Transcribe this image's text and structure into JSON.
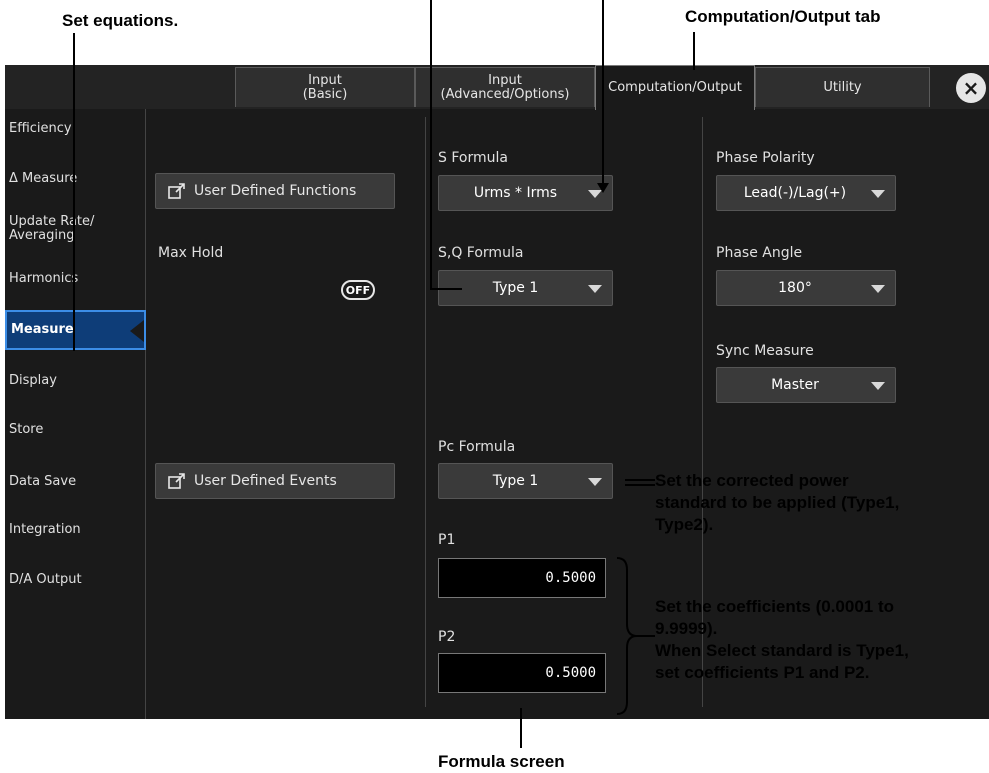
{
  "annotations": {
    "set_equations": "Set equations.",
    "tab_callout": "Computation/Output tab",
    "pc_note": [
      "Set the corrected power",
      "standard to be applied (Type1,",
      "Type2)."
    ],
    "coef_note": [
      "Set the coefficients (0.0001 to",
      "9.9999).",
      "When Select standard is Type1,",
      "set coefficients P1 and P2."
    ],
    "formula_screen": "Formula screen"
  },
  "tabs": [
    {
      "line1": "Input",
      "line2": "(Basic)"
    },
    {
      "line1": "Input",
      "line2": "(Advanced/Options)"
    },
    {
      "line1": "Computation/Output",
      "line2": ""
    },
    {
      "line1": "Utility",
      "line2": ""
    }
  ],
  "close_icon": "×",
  "sidebar": {
    "items": [
      {
        "label": "Efficiency"
      },
      {
        "label": "Δ Measure"
      },
      {
        "label": "Update Rate/ Averaging"
      },
      {
        "label": "Harmonics"
      },
      {
        "label": "Measure"
      },
      {
        "label": "Display"
      },
      {
        "label": "Store"
      },
      {
        "label": "Data Save"
      },
      {
        "label": "Integration"
      },
      {
        "label": "D/A Output"
      }
    ]
  },
  "left_col": {
    "udf_button": "User Defined Functions",
    "max_hold_label": "Max Hold",
    "max_hold_toggle": "OFF",
    "ude_button": "User Defined Events"
  },
  "middle_col": {
    "s_formula_label": "S Formula",
    "s_formula_value": "Urms * Irms",
    "sq_formula_label": "S,Q Formula",
    "sq_formula_value": "Type 1",
    "pc_formula_label": "Pc Formula",
    "pc_formula_value": "Type 1",
    "p1_label": "P1",
    "p1_value": "0.5000",
    "p2_label": "P2",
    "p2_value": "0.5000"
  },
  "right_col": {
    "phase_polarity_label": "Phase Polarity",
    "phase_polarity_value": "Lead(-)/Lag(+)",
    "phase_angle_label": "Phase Angle",
    "phase_angle_value": "180°",
    "sync_measure_label": "Sync Measure",
    "sync_measure_value": "Master"
  },
  "icons": [
    "external-link-icon",
    "dropdown-arrow-icon",
    "close-icon",
    "selected-pointer-icon"
  ],
  "colors": {
    "active_sidebar": "#0e3d78",
    "active_border": "#3c8de6",
    "panel_bg": "#1a1a1a"
  }
}
